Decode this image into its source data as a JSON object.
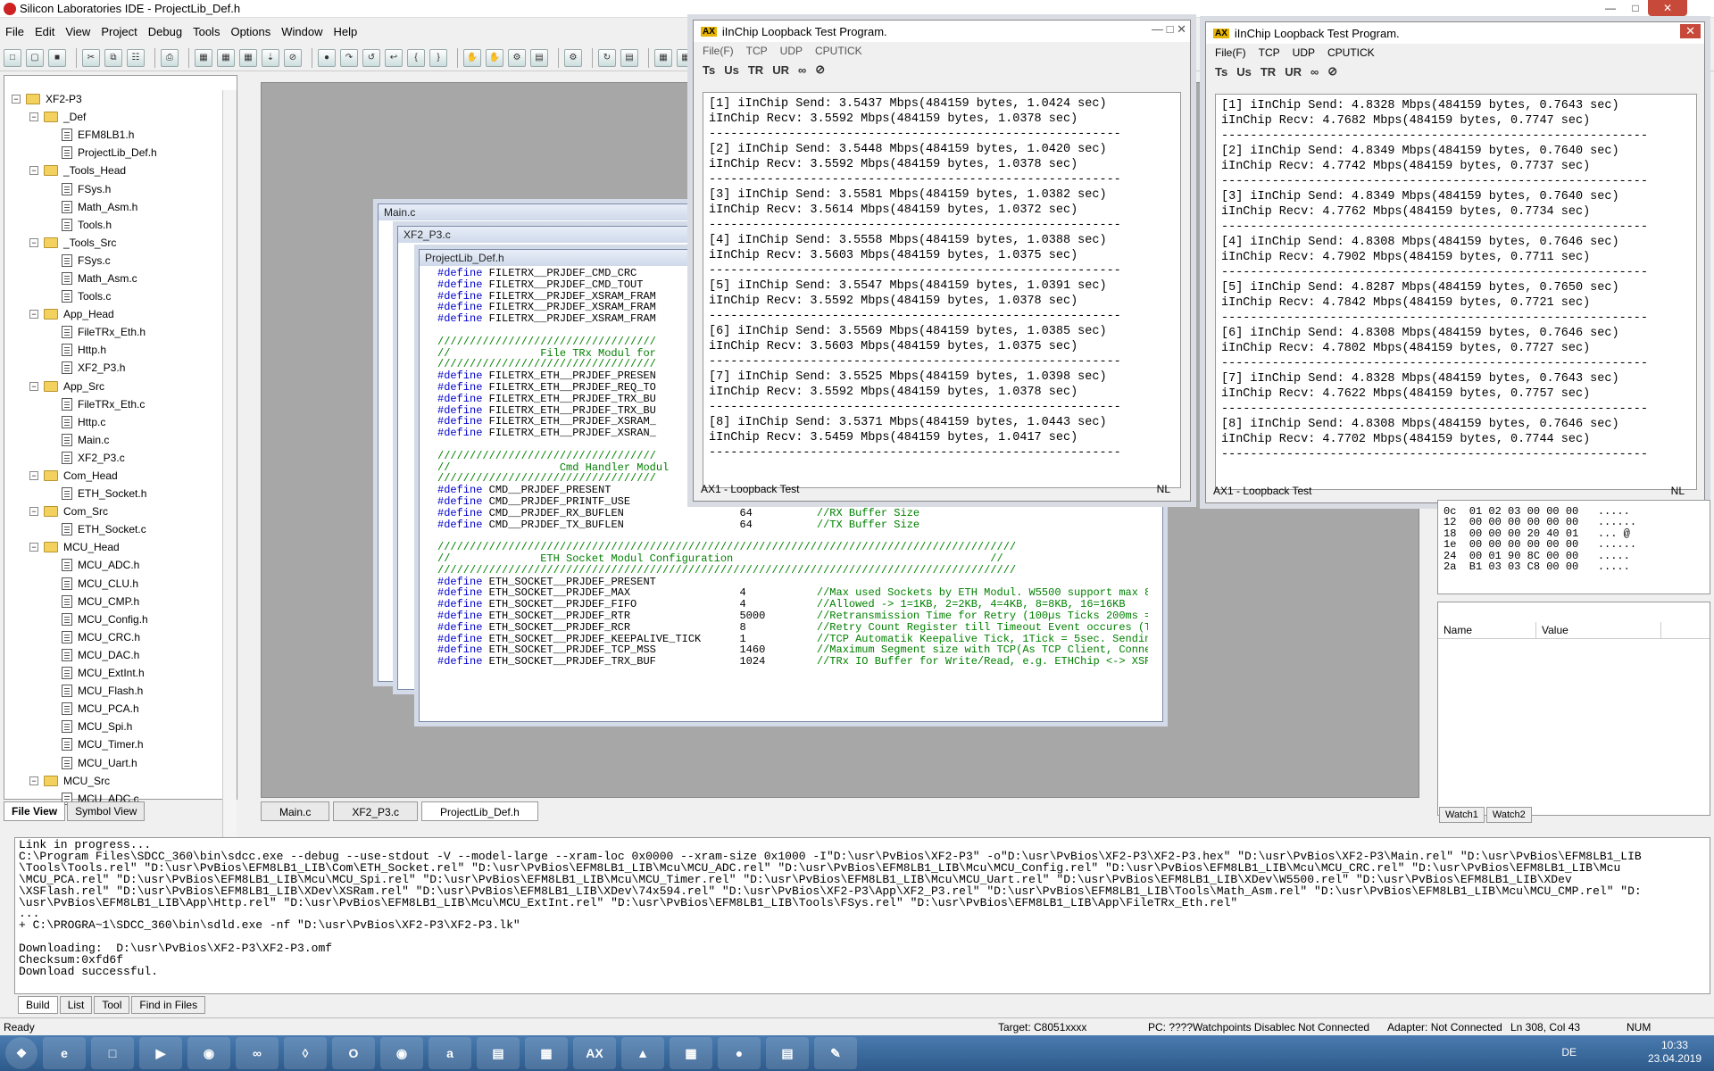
{
  "app": {
    "title": "Silicon Laboratories IDE - ProjectLib_Def.h"
  },
  "menu": [
    "File",
    "Edit",
    "View",
    "Project",
    "Debug",
    "Tools",
    "Options",
    "Window",
    "Help"
  ],
  "tree": [
    {
      "label": "XF2-P3",
      "level": 0,
      "type": "root"
    },
    {
      "label": "_Def",
      "level": 1,
      "type": "folder"
    },
    {
      "label": "EFM8LB1.h",
      "level": 2,
      "type": "file"
    },
    {
      "label": "ProjectLib_Def.h",
      "level": 2,
      "type": "file"
    },
    {
      "label": "_Tools_Head",
      "level": 1,
      "type": "folder"
    },
    {
      "label": "FSys.h",
      "level": 2,
      "type": "file"
    },
    {
      "label": "Math_Asm.h",
      "level": 2,
      "type": "file"
    },
    {
      "label": "Tools.h",
      "level": 2,
      "type": "file"
    },
    {
      "label": "_Tools_Src",
      "level": 1,
      "type": "folder"
    },
    {
      "label": "FSys.c",
      "level": 2,
      "type": "file"
    },
    {
      "label": "Math_Asm.c",
      "level": 2,
      "type": "file"
    },
    {
      "label": "Tools.c",
      "level": 2,
      "type": "file"
    },
    {
      "label": "App_Head",
      "level": 1,
      "type": "folder"
    },
    {
      "label": "FileTRx_Eth.h",
      "level": 2,
      "type": "file"
    },
    {
      "label": "Http.h",
      "level": 2,
      "type": "file"
    },
    {
      "label": "XF2_P3.h",
      "level": 2,
      "type": "file"
    },
    {
      "label": "App_Src",
      "level": 1,
      "type": "folder"
    },
    {
      "label": "FileTRx_Eth.c",
      "level": 2,
      "type": "file"
    },
    {
      "label": "Http.c",
      "level": 2,
      "type": "file"
    },
    {
      "label": "Main.c",
      "level": 2,
      "type": "file"
    },
    {
      "label": "XF2_P3.c",
      "level": 2,
      "type": "file"
    },
    {
      "label": "Com_Head",
      "level": 1,
      "type": "folder"
    },
    {
      "label": "ETH_Socket.h",
      "level": 2,
      "type": "file"
    },
    {
      "label": "Com_Src",
      "level": 1,
      "type": "folder"
    },
    {
      "label": "ETH_Socket.c",
      "level": 2,
      "type": "file"
    },
    {
      "label": "MCU_Head",
      "level": 1,
      "type": "folder"
    },
    {
      "label": "MCU_ADC.h",
      "level": 2,
      "type": "file"
    },
    {
      "label": "MCU_CLU.h",
      "level": 2,
      "type": "file"
    },
    {
      "label": "MCU_CMP.h",
      "level": 2,
      "type": "file"
    },
    {
      "label": "MCU_Config.h",
      "level": 2,
      "type": "file"
    },
    {
      "label": "MCU_CRC.h",
      "level": 2,
      "type": "file"
    },
    {
      "label": "MCU_DAC.h",
      "level": 2,
      "type": "file"
    },
    {
      "label": "MCU_ExtInt.h",
      "level": 2,
      "type": "file"
    },
    {
      "label": "MCU_Flash.h",
      "level": 2,
      "type": "file"
    },
    {
      "label": "MCU_PCA.h",
      "level": 2,
      "type": "file"
    },
    {
      "label": "MCU_Spi.h",
      "level": 2,
      "type": "file"
    },
    {
      "label": "MCU_Timer.h",
      "level": 2,
      "type": "file"
    },
    {
      "label": "MCU_Uart.h",
      "level": 2,
      "type": "file"
    },
    {
      "label": "MCU_Src",
      "level": 1,
      "type": "folder"
    },
    {
      "label": "MCU_ADC.c",
      "level": 2,
      "type": "file"
    }
  ],
  "left_tabs": [
    "File View",
    "Symbol View"
  ],
  "mdi": {
    "win1": "Main.c",
    "win2": "XF2_P3.c",
    "win3": "ProjectLib_Def.h",
    "tabs": [
      "Main.c",
      "XF2_P3.c",
      "ProjectLib_Def.h"
    ]
  },
  "code": "#define FILETRX__PRJDEF_CMD_CRC\n#define FILETRX__PRJDEF_CMD_TOUT\n#define FILETRX__PRJDEF_XSRAM_FRAM\n#define FILETRX__PRJDEF_XSRAM_FRAM\n#define FILETRX__PRJDEF_XSRAM_FRAM\n\n//////////////////////////////////\n//              File TRx Modul for\n//////////////////////////////////\n#define FILETRX_ETH__PRJDEF_PRESEN\n#define FILETRX_ETH__PRJDEF_REQ_TO\n#define FILETRX_ETH__PRJDEF_TRX_BU\n#define FILETRX_ETH__PRJDEF_TRX_BU\n#define FILETRX_ETH__PRJDEF_XSRAM_\n#define FILETRX_ETH__PRJDEF_XSRAN_\n\n//////////////////////////////////\n//                 Cmd Handler Modul\n//////////////////////////////////\n#define CMD__PRJDEF_PRESENT\n#define CMD__PRJDEF_PRINTF_USE                 1           //Use Special Printf(tools.c) instead of sprintf\n#define CMD__PRJDEF_RX_BUFLEN                  64          //RX Buffer Size\n#define CMD__PRJDEF_TX_BUFLEN                  64          //TX Buffer Size\n\n//////////////////////////////////////////////////////////////////////////////////////////\n//              ETH Socket Modul Configuration                                        //\n//////////////////////////////////////////////////////////////////////////////////////////\n#define ETH_SOCKET__PRJDEF_PRESENT\n#define ETH_SOCKET__PRJDEF_MAX                 4           //Max used Sockets by ETH Modul. W5500 support max 8 Sockets wi\n#define ETH_SOCKET__PRJDEF_FIFO                4           //Allowed -> 1=1KB, 2=2KB, 4=4KB, 8=8KB, 16=16KB\n#define ETH_SOCKET__PRJDEF_RTR                 5000        //Retransmission Time for Retry (100µs Ticks 200ms = 2000 = Defa\n#define ETH_SOCKET__PRJDEF_RCR                 8           //Retry Count Register till Timeout Event occures (Timeout = RC\n#define ETH_SOCKET__PRJDEF_KEEPALIVE_TICK      1           //TCP Automatik Keepalive Tick, 1Tick = 5sec. Sending Keepalive\n#define ETH_SOCKET__PRJDEF_TCP_MSS             1460        //Maximum Segment size with TCP(As TCP Client, Connect Process\n#define ETH_SOCKET__PRJDEF_TRX_BUF             1024        //TRx IO Buffer for Write/Read, e.g. ETHChip <-> XSRam or ETHCh",
  "loopback1": {
    "title": "iInChip Loopback Test Program.",
    "menu": [
      "File(F)",
      "TCP",
      "UDP",
      "CPUTICK"
    ],
    "status": "AX1 - Loopback Test",
    "status_right": "NL",
    "log": "[1] iInChip Send: 3.5437 Mbps(484159 bytes, 1.0424 sec)\niInChip Recv: 3.5592 Mbps(484159 bytes, 1.0378 sec)\n---------------------------------------------------------\n[2] iInChip Send: 3.5448 Mbps(484159 bytes, 1.0420 sec)\niInChip Recv: 3.5592 Mbps(484159 bytes, 1.0378 sec)\n---------------------------------------------------------\n[3] iInChip Send: 3.5581 Mbps(484159 bytes, 1.0382 sec)\niInChip Recv: 3.5614 Mbps(484159 bytes, 1.0372 sec)\n---------------------------------------------------------\n[4] iInChip Send: 3.5558 Mbps(484159 bytes, 1.0388 sec)\niInChip Recv: 3.5603 Mbps(484159 bytes, 1.0375 sec)\n---------------------------------------------------------\n[5] iInChip Send: 3.5547 Mbps(484159 bytes, 1.0391 sec)\niInChip Recv: 3.5592 Mbps(484159 bytes, 1.0378 sec)\n---------------------------------------------------------\n[6] iInChip Send: 3.5569 Mbps(484159 bytes, 1.0385 sec)\niInChip Recv: 3.5603 Mbps(484159 bytes, 1.0375 sec)\n---------------------------------------------------------\n[7] iInChip Send: 3.5525 Mbps(484159 bytes, 1.0398 sec)\niInChip Recv: 3.5592 Mbps(484159 bytes, 1.0378 sec)\n---------------------------------------------------------\n[8] iInChip Send: 3.5371 Mbps(484159 bytes, 1.0443 sec)\niInChip Recv: 3.5459 Mbps(484159 bytes, 1.0417 sec)\n---------------------------------------------------------"
  },
  "loopback2": {
    "title": "iInChip Loopback Test Program.",
    "menu": [
      "File(F)",
      "TCP",
      "UDP",
      "CPUTICK"
    ],
    "status": "AX1 - Loopback Test",
    "status_right": "NL",
    "log": "[1] iInChip Send: 4.8328 Mbps(484159 bytes, 0.7643 sec)\niInChip Recv: 4.7682 Mbps(484159 bytes, 0.7747 sec)\n-----------------------------------------------------------\n[2] iInChip Send: 4.8349 Mbps(484159 bytes, 0.7640 sec)\niInChip Recv: 4.7742 Mbps(484159 bytes, 0.7737 sec)\n-----------------------------------------------------------\n[3] iInChip Send: 4.8349 Mbps(484159 bytes, 0.7640 sec)\niInChip Recv: 4.7762 Mbps(484159 bytes, 0.7734 sec)\n-----------------------------------------------------------\n[4] iInChip Send: 4.8308 Mbps(484159 bytes, 0.7646 sec)\niInChip Recv: 4.7902 Mbps(484159 bytes, 0.7711 sec)\n-----------------------------------------------------------\n[5] iInChip Send: 4.8287 Mbps(484159 bytes, 0.7650 sec)\niInChip Recv: 4.7842 Mbps(484159 bytes, 0.7721 sec)\n-----------------------------------------------------------\n[6] iInChip Send: 4.8308 Mbps(484159 bytes, 0.7646 sec)\niInChip Recv: 4.7802 Mbps(484159 bytes, 0.7727 sec)\n-----------------------------------------------------------\n[7] iInChip Send: 4.8328 Mbps(484159 bytes, 0.7643 sec)\niInChip Recv: 4.7622 Mbps(484159 bytes, 0.7757 sec)\n-----------------------------------------------------------\n[8] iInChip Send: 4.8308 Mbps(484159 bytes, 0.7646 sec)\niInChip Recv: 4.7702 Mbps(484159 bytes, 0.7744 sec)\n-----------------------------------------------------------"
  },
  "memory": "0c  01 02 03 00 00 00   .....\n12  00 00 00 00 00 00   ......\n18  00 00 00 20 40 01   ... @\n1e  00 00 00 00 00 00   ......\n24  00 01 90 8C 00 00   .....\n2a  B1 03 03 C8 00 00   .....",
  "watch": {
    "col_name": "Name",
    "col_value": "Value",
    "tabs": [
      "Watch1",
      "Watch2"
    ]
  },
  "output_log": "Link in progress...\nC:\\Program Files\\SDCC_360\\bin\\sdcc.exe --debug --use-stdout -V --model-large --xram-loc 0x0000 --xram-size 0x1000 -I\"D:\\usr\\PvBios\\XF2-P3\" -o\"D:\\usr\\PvBios\\XF2-P3\\XF2-P3.hex\" \"D:\\usr\\PvBios\\XF2-P3\\Main.rel\" \"D:\\usr\\PvBios\\EFM8LB1_LIB\n\\Tools\\Tools.rel\" \"D:\\usr\\PvBios\\EFM8LB1_LIB\\Com\\ETH_Socket.rel\" \"D:\\usr\\PvBios\\EFM8LB1_LIB\\Mcu\\MCU_ADC.rel\" \"D:\\usr\\PvBios\\EFM8LB1_LIB\\Mcu\\MCU_Config.rel\" \"D:\\usr\\PvBios\\EFM8LB1_LIB\\Mcu\\MCU_CRC.rel\" \"D:\\usr\\PvBios\\EFM8LB1_LIB\\Mcu\n\\MCU_PCA.rel\" \"D:\\usr\\PvBios\\EFM8LB1_LIB\\Mcu\\MCU_Spi.rel\" \"D:\\usr\\PvBios\\EFM8LB1_LIB\\Mcu\\MCU_Timer.rel\" \"D:\\usr\\PvBios\\EFM8LB1_LIB\\Mcu\\MCU_Uart.rel\" \"D:\\usr\\PvBios\\EFM8LB1_LIB\\XDev\\W5500.rel\" \"D:\\usr\\PvBios\\EFM8LB1_LIB\\XDev\n\\XSFlash.rel\" \"D:\\usr\\PvBios\\EFM8LB1_LIB\\XDev\\XSRam.rel\" \"D:\\usr\\PvBios\\EFM8LB1_LIB\\XDev\\74x594.rel\" \"D:\\usr\\PvBios\\XF2-P3\\App\\XF2_P3.rel\" \"D:\\usr\\PvBios\\EFM8LB1_LIB\\Tools\\Math_Asm.rel\" \"D:\\usr\\PvBios\\EFM8LB1_LIB\\Mcu\\MCU_CMP.rel\" \"D:\n\\usr\\PvBios\\EFM8LB1_LIB\\App\\Http.rel\" \"D:\\usr\\PvBios\\EFM8LB1_LIB\\Mcu\\MCU_ExtInt.rel\" \"D:\\usr\\PvBios\\EFM8LB1_LIB\\Tools\\FSys.rel\" \"D:\\usr\\PvBios\\EFM8LB1_LIB\\App\\FileTRx_Eth.rel\"\n...\n+ C:\\PROGRA~1\\SDCC_360\\bin\\sdld.exe -nf \"D:\\usr\\PvBios\\XF2-P3\\XF2-P3.lk\"\n\nDownloading:  D:\\usr\\PvBios\\XF2-P3\\XF2-P3.omf\nChecksum:0xfd6f\nDownload successful.",
  "output_tabs": [
    "Build",
    "List",
    "Tool",
    "Find in Files"
  ],
  "status": {
    "ready": "Ready",
    "target": "Target: C8051xxxx",
    "pc": "PC: ????",
    "watchpoints": "Watchpoints Disablec",
    "conn": "Not Connected",
    "adapter": "Adapter: Not Connected",
    "lncol": "Ln 308, Col 43",
    "num": "NUM"
  },
  "taskbar": {
    "apps": [
      "IE",
      "Explorer",
      "Media",
      "Chrome",
      "VS",
      "Tool",
      "Outlook",
      "Firefox",
      "Amazon",
      "Net",
      "Tool",
      "AX1",
      "App",
      "Calc",
      "SiLabs",
      "Chart",
      "Paint"
    ],
    "lang": "DE",
    "time": "10:33",
    "date": "23.04.2019"
  }
}
